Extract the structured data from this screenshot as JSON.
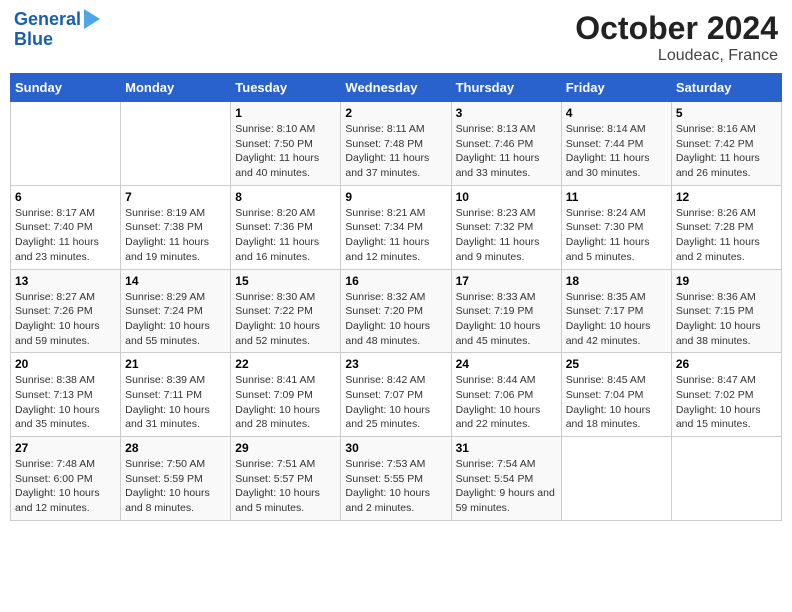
{
  "header": {
    "logo_line1": "General",
    "logo_line2": "Blue",
    "title": "October 2024",
    "subtitle": "Loudeac, France"
  },
  "days_of_week": [
    "Sunday",
    "Monday",
    "Tuesday",
    "Wednesday",
    "Thursday",
    "Friday",
    "Saturday"
  ],
  "weeks": [
    [
      {
        "day": "",
        "info": ""
      },
      {
        "day": "",
        "info": ""
      },
      {
        "day": "1",
        "info": "Sunrise: 8:10 AM\nSunset: 7:50 PM\nDaylight: 11 hours and 40 minutes."
      },
      {
        "day": "2",
        "info": "Sunrise: 8:11 AM\nSunset: 7:48 PM\nDaylight: 11 hours and 37 minutes."
      },
      {
        "day": "3",
        "info": "Sunrise: 8:13 AM\nSunset: 7:46 PM\nDaylight: 11 hours and 33 minutes."
      },
      {
        "day": "4",
        "info": "Sunrise: 8:14 AM\nSunset: 7:44 PM\nDaylight: 11 hours and 30 minutes."
      },
      {
        "day": "5",
        "info": "Sunrise: 8:16 AM\nSunset: 7:42 PM\nDaylight: 11 hours and 26 minutes."
      }
    ],
    [
      {
        "day": "6",
        "info": "Sunrise: 8:17 AM\nSunset: 7:40 PM\nDaylight: 11 hours and 23 minutes."
      },
      {
        "day": "7",
        "info": "Sunrise: 8:19 AM\nSunset: 7:38 PM\nDaylight: 11 hours and 19 minutes."
      },
      {
        "day": "8",
        "info": "Sunrise: 8:20 AM\nSunset: 7:36 PM\nDaylight: 11 hours and 16 minutes."
      },
      {
        "day": "9",
        "info": "Sunrise: 8:21 AM\nSunset: 7:34 PM\nDaylight: 11 hours and 12 minutes."
      },
      {
        "day": "10",
        "info": "Sunrise: 8:23 AM\nSunset: 7:32 PM\nDaylight: 11 hours and 9 minutes."
      },
      {
        "day": "11",
        "info": "Sunrise: 8:24 AM\nSunset: 7:30 PM\nDaylight: 11 hours and 5 minutes."
      },
      {
        "day": "12",
        "info": "Sunrise: 8:26 AM\nSunset: 7:28 PM\nDaylight: 11 hours and 2 minutes."
      }
    ],
    [
      {
        "day": "13",
        "info": "Sunrise: 8:27 AM\nSunset: 7:26 PM\nDaylight: 10 hours and 59 minutes."
      },
      {
        "day": "14",
        "info": "Sunrise: 8:29 AM\nSunset: 7:24 PM\nDaylight: 10 hours and 55 minutes."
      },
      {
        "day": "15",
        "info": "Sunrise: 8:30 AM\nSunset: 7:22 PM\nDaylight: 10 hours and 52 minutes."
      },
      {
        "day": "16",
        "info": "Sunrise: 8:32 AM\nSunset: 7:20 PM\nDaylight: 10 hours and 48 minutes."
      },
      {
        "day": "17",
        "info": "Sunrise: 8:33 AM\nSunset: 7:19 PM\nDaylight: 10 hours and 45 minutes."
      },
      {
        "day": "18",
        "info": "Sunrise: 8:35 AM\nSunset: 7:17 PM\nDaylight: 10 hours and 42 minutes."
      },
      {
        "day": "19",
        "info": "Sunrise: 8:36 AM\nSunset: 7:15 PM\nDaylight: 10 hours and 38 minutes."
      }
    ],
    [
      {
        "day": "20",
        "info": "Sunrise: 8:38 AM\nSunset: 7:13 PM\nDaylight: 10 hours and 35 minutes."
      },
      {
        "day": "21",
        "info": "Sunrise: 8:39 AM\nSunset: 7:11 PM\nDaylight: 10 hours and 31 minutes."
      },
      {
        "day": "22",
        "info": "Sunrise: 8:41 AM\nSunset: 7:09 PM\nDaylight: 10 hours and 28 minutes."
      },
      {
        "day": "23",
        "info": "Sunrise: 8:42 AM\nSunset: 7:07 PM\nDaylight: 10 hours and 25 minutes."
      },
      {
        "day": "24",
        "info": "Sunrise: 8:44 AM\nSunset: 7:06 PM\nDaylight: 10 hours and 22 minutes."
      },
      {
        "day": "25",
        "info": "Sunrise: 8:45 AM\nSunset: 7:04 PM\nDaylight: 10 hours and 18 minutes."
      },
      {
        "day": "26",
        "info": "Sunrise: 8:47 AM\nSunset: 7:02 PM\nDaylight: 10 hours and 15 minutes."
      }
    ],
    [
      {
        "day": "27",
        "info": "Sunrise: 7:48 AM\nSunset: 6:00 PM\nDaylight: 10 hours and 12 minutes."
      },
      {
        "day": "28",
        "info": "Sunrise: 7:50 AM\nSunset: 5:59 PM\nDaylight: 10 hours and 8 minutes."
      },
      {
        "day": "29",
        "info": "Sunrise: 7:51 AM\nSunset: 5:57 PM\nDaylight: 10 hours and 5 minutes."
      },
      {
        "day": "30",
        "info": "Sunrise: 7:53 AM\nSunset: 5:55 PM\nDaylight: 10 hours and 2 minutes."
      },
      {
        "day": "31",
        "info": "Sunrise: 7:54 AM\nSunset: 5:54 PM\nDaylight: 9 hours and 59 minutes."
      },
      {
        "day": "",
        "info": ""
      },
      {
        "day": "",
        "info": ""
      }
    ]
  ]
}
